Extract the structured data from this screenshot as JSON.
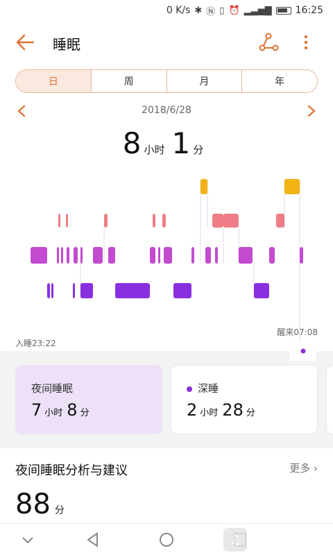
{
  "status_bar": {
    "speed": "0 K/s",
    "network": "4G",
    "time": "16:25"
  },
  "app_bar": {
    "title": "睡眠"
  },
  "tabs": [
    "日",
    "周",
    "月",
    "年"
  ],
  "date": "2018/6/28",
  "total": {
    "hours": "8",
    "hours_unit": "小时",
    "minutes": "1",
    "minutes_unit": "分"
  },
  "chart": {
    "sleep_start_label": "入睡23:22",
    "wake_label": "醒来07:08",
    "colors": {
      "awake": "#f2b414",
      "rem": "#ef7d85",
      "light": "#c24bd0",
      "deep": "#8a2fe0"
    }
  },
  "stats": {
    "night_sleep": {
      "label": "夜间睡眠",
      "hours": "7",
      "hours_unit": "小时",
      "minutes": "8",
      "minutes_unit": "分"
    },
    "deep_sleep": {
      "label": "深睡",
      "hours": "2",
      "hours_unit": "小时",
      "minutes": "28",
      "minutes_unit": "分"
    }
  },
  "analysis": {
    "title": "夜间睡眠分析与建议",
    "more": "更多",
    "score": "88",
    "score_unit": "分"
  }
}
